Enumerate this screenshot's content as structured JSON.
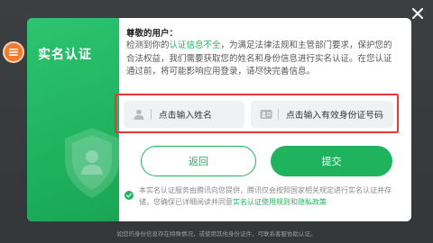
{
  "colors": {
    "primary_green": "#1fb35e",
    "highlight_red": "#e5383b",
    "menu_orange": "#f27b2f"
  },
  "icons": {
    "menu": "menu-icon",
    "close": "close-icon",
    "shield": "shield-user-icon",
    "name_field": "person-icon",
    "id_field": "id-card-icon",
    "agree": "check-circle-icon"
  },
  "dialog": {
    "title": "实名认证",
    "greeting": "尊敬的用户：",
    "notice_before": "检测到你的",
    "notice_highlight": "认证信息不全",
    "notice_after": "，为满足法律法规和主管部门要求，保护您的合法权益，我们需要获取您的姓名和身份信息进行实名认证。在您认证通过前，将可能影响应用登录，请尽快完善信息。"
  },
  "form": {
    "name_placeholder": "点击输入姓名",
    "id_placeholder": "点击输入有效身份证号码"
  },
  "buttons": {
    "back": "返回",
    "submit": "提交"
  },
  "agreement": {
    "text": "本实名认证服务由腾讯向您提供，腾讯仅会按照国家相关规定进行实名认证并存储，您确保已详细阅读并同意",
    "link1": "实名认证使用规则",
    "conj": "和",
    "link2": "隐私政策"
  },
  "footer_note": "如您的身份信息存在特殊情况，或使用其他身份证件，可联系客服协助认证。"
}
